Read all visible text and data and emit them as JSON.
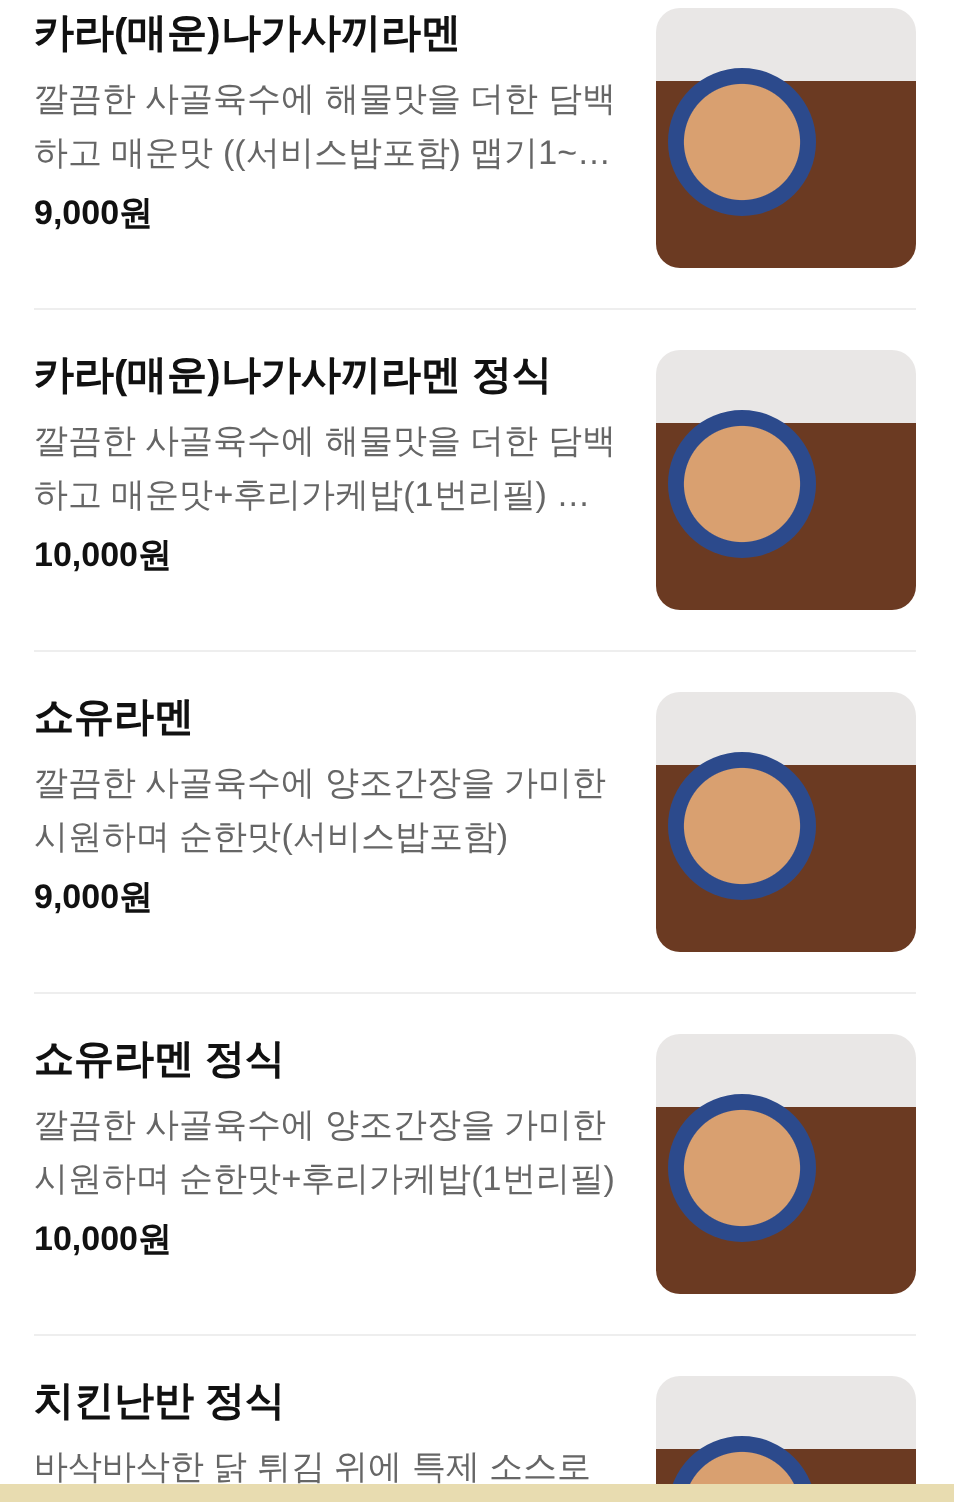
{
  "menu_items": [
    {
      "name": "카라(매운)나가사끼라멘",
      "description": "깔끔한 사골육수에 해물맛을 더한 담백하고 매운맛 ((서비스밥포함) 맵기1~…",
      "price": "9,000원"
    },
    {
      "name": "카라(매운)나가사끼라멘 정식",
      "description": "깔끔한 사골육수에 해물맛을 더한 담백하고 매운맛+후리가케밥(1번리필) …",
      "price": "10,000원"
    },
    {
      "name": "쇼유라멘",
      "description": "깔끔한 사골육수에 양조간장을 가미한 시원하며 순한맛(서비스밥포함)",
      "price": "9,000원"
    },
    {
      "name": "쇼유라멘 정식",
      "description": "깔끔한 사골육수에 양조간장을 가미한 시원하며 순한맛+후리가케밥(1번리필)",
      "price": "10,000원"
    },
    {
      "name": "치킨난반 정식",
      "description": "바삭바삭한 닭 튀김 위에 특제 소스로"
    }
  ]
}
